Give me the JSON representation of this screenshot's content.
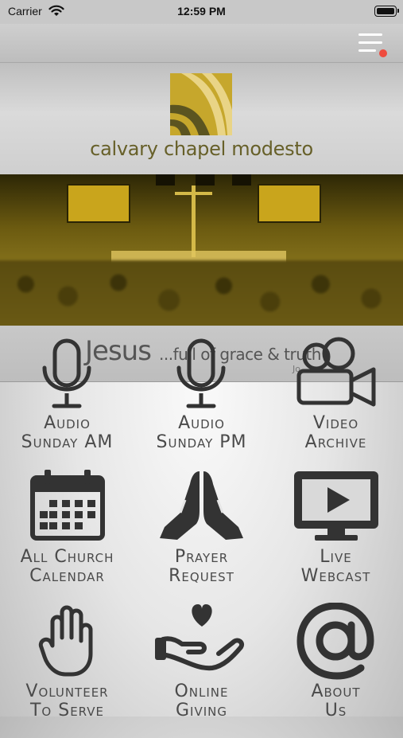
{
  "status_bar": {
    "carrier": "Carrier",
    "time": "12:59 PM"
  },
  "header": {
    "menu_icon": "hamburger-menu-icon",
    "notification_color": "#ee4b3e"
  },
  "logo": {
    "text": "calvary chapel modesto",
    "color": "#676029",
    "accent": "#c6a72c"
  },
  "banner": {
    "caption_main": "Jesus",
    "caption_sub": "...full of grace & truth",
    "caption_ref": "Jo"
  },
  "tiles": [
    {
      "id": "audio-sunday-am",
      "icon": "microphone-icon",
      "line1": "Audio",
      "line2": "Sunday AM"
    },
    {
      "id": "audio-sunday-pm",
      "icon": "microphone-icon",
      "line1": "Audio",
      "line2": "Sunday PM"
    },
    {
      "id": "video-archive",
      "icon": "video-camera-icon",
      "line1": "Video",
      "line2": "Archive"
    },
    {
      "id": "all-church-calendar",
      "icon": "calendar-icon",
      "line1": "All Church",
      "line2": "Calendar"
    },
    {
      "id": "prayer-request",
      "icon": "praying-hands-icon",
      "line1": "Prayer",
      "line2": "Request"
    },
    {
      "id": "live-webcast",
      "icon": "monitor-play-icon",
      "line1": "Live",
      "line2": "Webcast"
    },
    {
      "id": "volunteer-to-serve",
      "icon": "raised-hand-icon",
      "line1": "Volunteer",
      "line2": "To Serve"
    },
    {
      "id": "online-giving",
      "icon": "heart-in-hand-icon",
      "line1": "Online",
      "line2": "Giving"
    },
    {
      "id": "about-us",
      "icon": "at-sign-icon",
      "line1": "About",
      "line2": "Us"
    }
  ]
}
